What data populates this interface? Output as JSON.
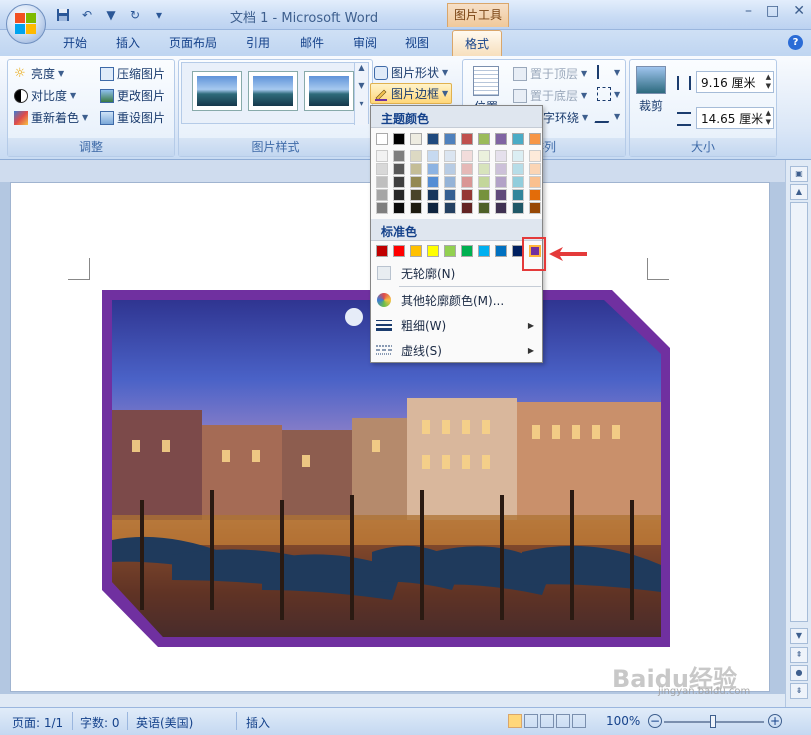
{
  "window": {
    "title": "文档 1 - Microsoft Word",
    "tool_tab_title": "图片工具"
  },
  "tabs": [
    "开始",
    "插入",
    "页面布局",
    "引用",
    "邮件",
    "审阅",
    "视图"
  ],
  "active_tab": "格式",
  "ribbon": {
    "adjust": {
      "label": "调整",
      "brightness": "亮度",
      "contrast": "对比度",
      "recolor": "重新着色",
      "compress": "压缩图片",
      "change": "更改图片",
      "reset": "重设图片"
    },
    "picture_styles": {
      "label": "图片样式",
      "shape": "图片形状",
      "border": "图片边框"
    },
    "arrange": {
      "label": "排列",
      "position": "位置",
      "bring_front": "置于顶层",
      "send_back": "置于底层",
      "text_wrap": "文字环绕",
      "partial_wrap_label": "字环绕"
    },
    "size": {
      "label": "大小",
      "crop": "裁剪",
      "height": "9.16 厘米",
      "width": "14.65 厘米"
    }
  },
  "dropdown": {
    "theme_colors_title": "主题颜色",
    "standard_colors_title": "标准色",
    "no_outline": "无轮廓(N)",
    "more_colors": "其他轮廓颜色(M)...",
    "weight": "粗细(W)",
    "dashes": "虚线(S)",
    "theme_top": [
      "#ffffff",
      "#000000",
      "#eeece1",
      "#1f497d",
      "#4f81bd",
      "#c0504d",
      "#9bbb59",
      "#8064a2",
      "#4bacc6",
      "#f79646"
    ],
    "theme_shades": [
      [
        "#f2f2f2",
        "#d8d8d8",
        "#bfbfbf",
        "#a5a5a5",
        "#7f7f7f"
      ],
      [
        "#7f7f7f",
        "#595959",
        "#3f3f3f",
        "#262626",
        "#0c0c0c"
      ],
      [
        "#ddd9c3",
        "#c4bd97",
        "#938953",
        "#494429",
        "#1d1b10"
      ],
      [
        "#c6d9f0",
        "#8db3e2",
        "#548dd4",
        "#17365d",
        "#0f243e"
      ],
      [
        "#dbe5f1",
        "#b8cce4",
        "#95b3d7",
        "#366092",
        "#244061"
      ],
      [
        "#f2dcdb",
        "#e5b9b7",
        "#d99694",
        "#953734",
        "#632423"
      ],
      [
        "#ebf1dd",
        "#d7e3bc",
        "#c3d69b",
        "#76923c",
        "#4f6128"
      ],
      [
        "#e5e0ec",
        "#ccc1d9",
        "#b2a2c7",
        "#5f497a",
        "#3f3151"
      ],
      [
        "#dbeef3",
        "#b7dde8",
        "#92cddc",
        "#31859b",
        "#205867"
      ],
      [
        "#fdeada",
        "#fbd5b5",
        "#fac08f",
        "#e36c09",
        "#974806"
      ]
    ],
    "standard": [
      "#c00000",
      "#ff0000",
      "#ffc000",
      "#ffff00",
      "#92d050",
      "#00b050",
      "#00b0f0",
      "#0070c0",
      "#002060",
      "#7030a0"
    ]
  },
  "statusbar": {
    "page": "页面: 1/1",
    "words": "字数: 0",
    "language": "英语(美国)",
    "mode": "插入",
    "zoom": "100%"
  },
  "watermark": {
    "text": "Baidu经验",
    "url": "jingyan.baidu.com"
  },
  "accent": {
    "frame_purple": "#7030a0"
  }
}
